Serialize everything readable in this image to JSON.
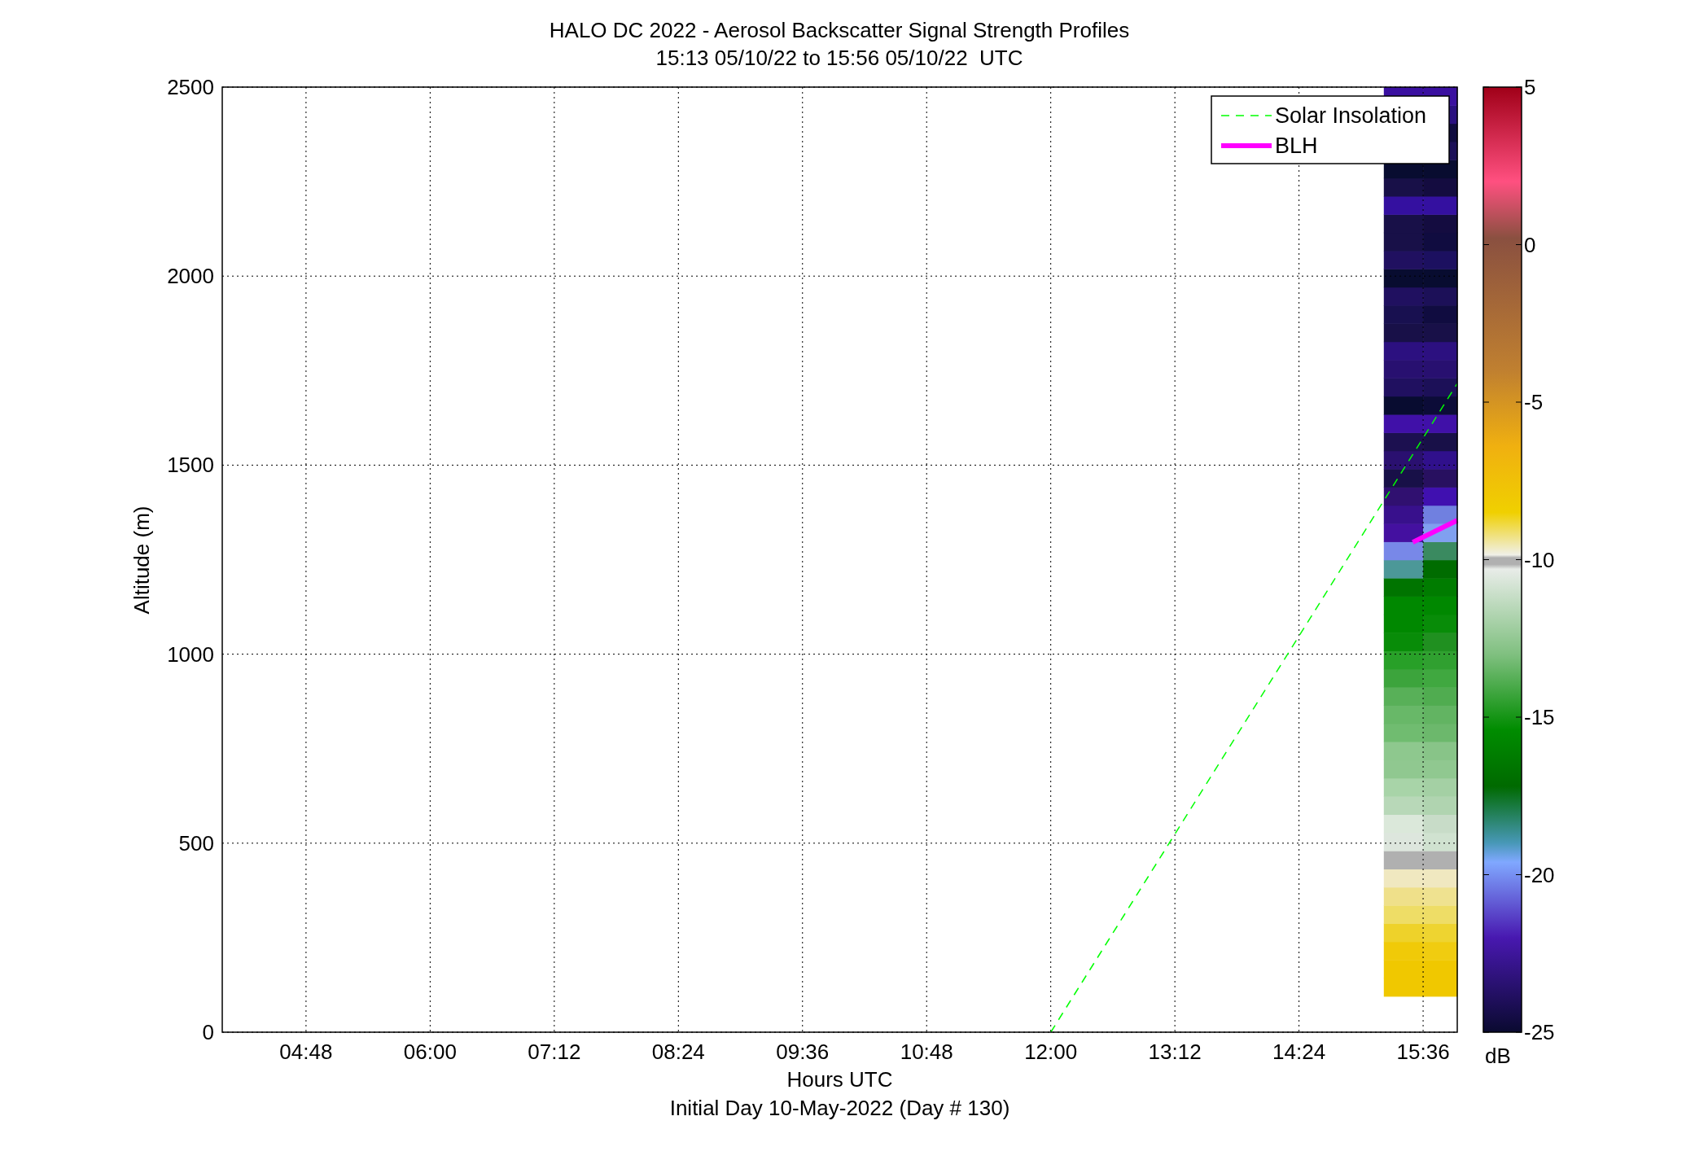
{
  "figure": {
    "title_lines": [
      "HALO DC 2022 - Aerosol Backscatter Signal Strength Profiles",
      "15:13 05/10/22 to 15:56 05/10/22  UTC"
    ],
    "caption": "Initial Day 10-May-2022 (Day # 130)",
    "chart_data": {
      "type": "line",
      "xlabel": "Hours UTC",
      "ylabel": "Altitude (m)",
      "xlim": [
        3.99,
        15.93
      ],
      "ylim": [
        0,
        2500
      ],
      "xticks": [
        {
          "value": 4.8,
          "label": "04:48"
        },
        {
          "value": 6,
          "label": "06:00"
        },
        {
          "value": 7.2,
          "label": "07:12"
        },
        {
          "value": 8.4,
          "label": "08:24"
        },
        {
          "value": 9.6,
          "label": "09:36"
        },
        {
          "value": 10.8,
          "label": "10:48"
        },
        {
          "value": 12,
          "label": "12:00"
        },
        {
          "value": 13.2,
          "label": "13:12"
        },
        {
          "value": 14.4,
          "label": "14:24"
        },
        {
          "value": 15.6,
          "label": "15:36"
        }
      ],
      "yticks": [
        {
          "value": 0,
          "label": "0"
        },
        {
          "value": 500,
          "label": "500"
        },
        {
          "value": 1000,
          "label": "1000"
        },
        {
          "value": 1500,
          "label": "1500"
        },
        {
          "value": 2000,
          "label": "2000"
        },
        {
          "value": 2500,
          "label": "2500"
        }
      ],
      "grid": true,
      "legend": true,
      "series": [
        {
          "name": "Solar Insolation",
          "color": "#00ff00",
          "line_style": "dashed",
          "x": [
            12.0,
            15.93
          ],
          "values": [
            0,
            1716
          ]
        },
        {
          "name": "BLH",
          "color": "#ff00ff",
          "line_style": "solid",
          "x": [
            15.5,
            15.93
          ],
          "values": [
            1296,
            1354
          ]
        }
      ]
    },
    "colorbar": {
      "label": "dB",
      "ticks": [
        "5",
        "0",
        "-5",
        "-10",
        "-15",
        "-20",
        "-25"
      ]
    }
  }
}
